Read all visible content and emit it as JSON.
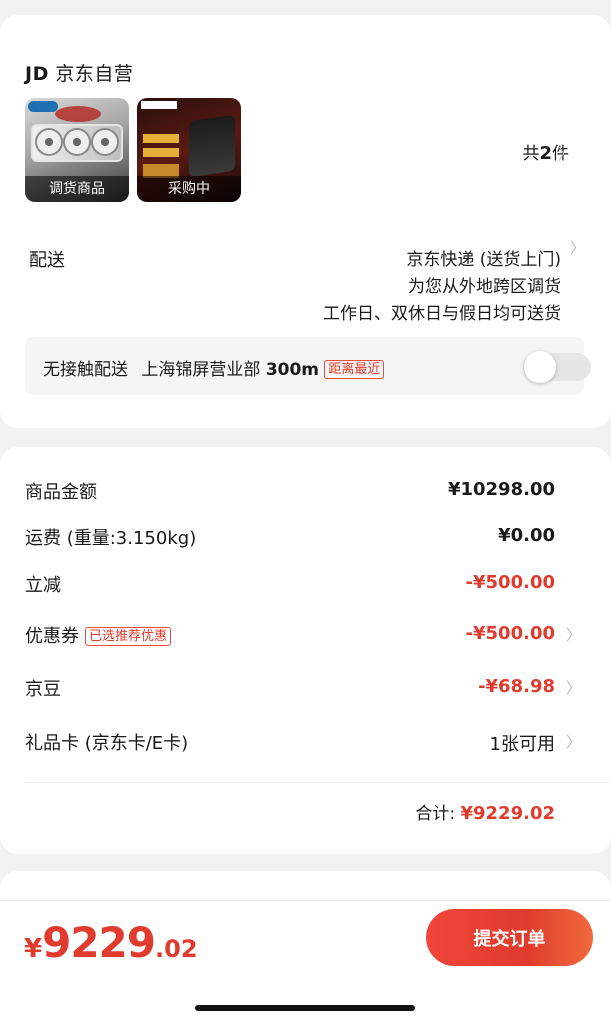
{
  "shop": {
    "logo": "JD",
    "name": "京东自营",
    "items": [
      {
        "caption": "调货商品"
      },
      {
        "caption": "采购中"
      }
    ],
    "count_prefix": "共",
    "count_value": "2",
    "count_suffix": "件"
  },
  "delivery": {
    "label": "配送",
    "lines": [
      "京东快递 (送货上门)",
      "为您从外地跨区调货",
      "工作日、双休日与假日均可送货"
    ],
    "contactless_label": "无接触配送",
    "store": "上海锦屏营业部",
    "distance": "300m",
    "distance_tag": "距离最近",
    "toggle_on": false
  },
  "price_rows": [
    {
      "label": "商品金额",
      "value": "¥10298.00"
    },
    {
      "label": "运费 (重量:3.150kg)",
      "value": "¥0.00"
    },
    {
      "label": "立减",
      "value": "-¥500.00"
    },
    {
      "label": "优惠券",
      "tag": "已选推荐优惠",
      "value": "-¥500.00"
    },
    {
      "label": "京豆",
      "value": "-¥68.98"
    },
    {
      "label": "礼品卡 (京东卡/E卡)",
      "value": "1张可用"
    }
  ],
  "total": {
    "label": "合计:",
    "amount": "¥9229.02"
  },
  "bottom": {
    "currency": "¥",
    "integer": "9229",
    "decimal": ".02",
    "submit_label": "提交订单"
  },
  "colors": {
    "accent": "#e03b2c",
    "background": "#f2f2f2"
  }
}
